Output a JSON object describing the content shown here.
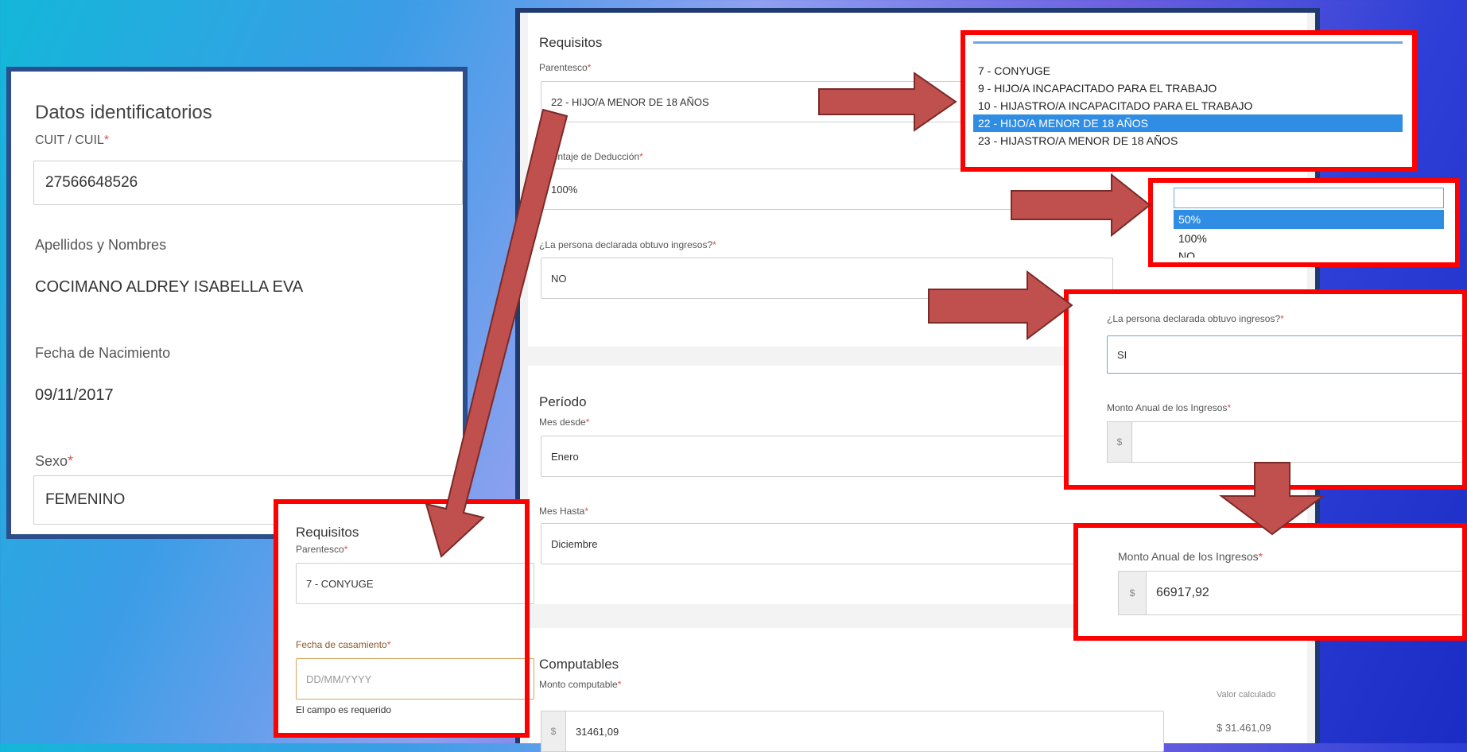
{
  "left_card": {
    "title": "Datos identificatorios",
    "cuit_label": "CUIT / CUIL",
    "required_mark": "*",
    "cuit_value": "27566648526",
    "names_label": "Apellidos y Nombres",
    "names_value": "COCIMANO ALDREY ISABELLA EVA",
    "birth_label": "Fecha de Nacimiento",
    "birth_value": "09/11/2017",
    "sex_label": "Sexo",
    "sex_value": "FEMENINO"
  },
  "main_form": {
    "requisitos_title": "Requisitos",
    "parentesco_label": "Parentesco",
    "parentesco_value": "22 - HIJO/A MENOR DE 18 AÑOS",
    "porcentaje_label": "orcentaje de Deducción",
    "porcentaje_value": "100%",
    "ingresos_label": "¿La persona declarada obtuvo ingresos?",
    "ingresos_value": "NO",
    "periodo_title": "Período",
    "mes_desde_label": "Mes desde",
    "mes_desde_value": "Enero",
    "mes_hasta_label": "Mes Hasta",
    "mes_hasta_value": "Diciembre",
    "computables_title": "Computables",
    "monto_computable_label": "Monto computable",
    "currency_prefix": "$",
    "monto_computable_value": "31461,09",
    "valor_calculado_label": "Valor calculado",
    "valor_calculado_value": "$ 31.461,09"
  },
  "parentesco_dropdown": {
    "options": [
      "7 - CONYUGE",
      "9 - HIJO/A INCAPACITADO PARA EL TRABAJO",
      "10 - HIJASTRO/A INCAPACITADO PARA EL TRABAJO",
      "22 - HIJO/A MENOR DE 18 AÑOS",
      "23 - HIJASTRO/A MENOR DE 18 AÑOS"
    ],
    "selected_index": 3
  },
  "porcentaje_dropdown": {
    "options": [
      "50%",
      "100%",
      "NO"
    ],
    "selected_index": 0
  },
  "conyuge_popup": {
    "title": "Requisitos",
    "parentesco_label": "Parentesco",
    "parentesco_value": "7 - CONYUGE",
    "fecha_label": "Fecha de casamiento",
    "fecha_placeholder": "DD/MM/YYYY",
    "error_text": "El campo es requerido"
  },
  "ingresos_popup": {
    "ingresos_label": "¿La persona declarada obtuvo ingresos?",
    "ingresos_value": "SI",
    "monto_label": "Monto Anual de los Ingresos",
    "currency_prefix": "$"
  },
  "monto_popup": {
    "monto_label": "Monto Anual de los Ingresos",
    "currency_prefix": "$",
    "monto_value": "66917,92"
  },
  "colors": {
    "highlight_red": "#ff0000",
    "arrow_fill": "#c0504d",
    "selected_blue": "#2f8de4",
    "card_border": "#2b4e8c"
  }
}
